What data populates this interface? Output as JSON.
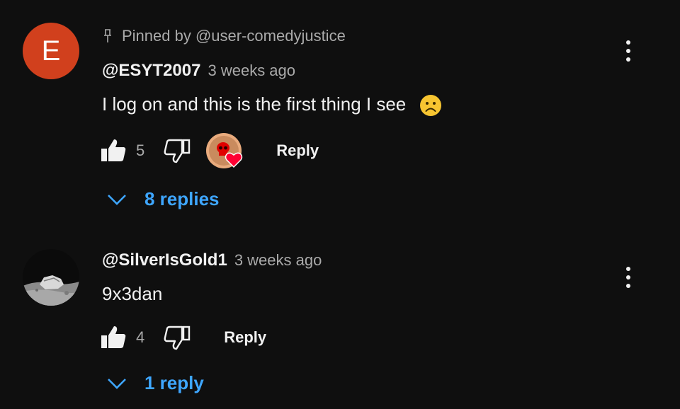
{
  "comments": [
    {
      "avatar_letter": "E",
      "avatar_color": "#d1401d",
      "pinned_label": "Pinned by @user-comedyjustice",
      "author": "@ESYT2007",
      "time": "3 weeks ago",
      "text": "I log on and this is the first thing I see",
      "emoji": "sad-face",
      "likes": "5",
      "creator_heart": true,
      "reply_label": "Reply",
      "replies_label": "8 replies"
    },
    {
      "avatar": "moon-rover-photo",
      "author": "@SilverIsGold1",
      "time": "3 weeks ago",
      "text": "9x3dan",
      "likes": "4",
      "reply_label": "Reply",
      "replies_label": "1 reply"
    }
  ],
  "colors": {
    "background": "#0f0f0f",
    "link_blue": "#3ea6ff",
    "secondary_text": "#aaaaaa",
    "heart_red": "#ff0033"
  }
}
